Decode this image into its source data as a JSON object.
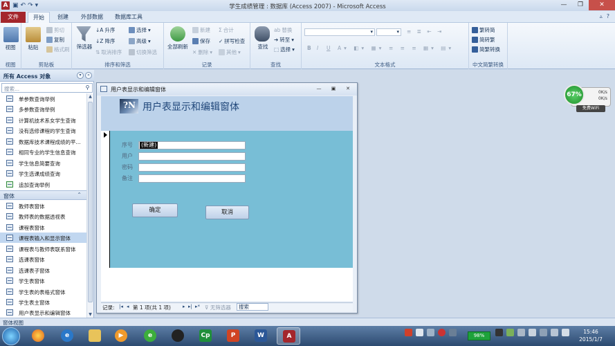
{
  "window": {
    "title": "学生成绩管理 : 数据库 (Access 2007) - Microsoft Access",
    "app_icon": "A"
  },
  "tabs": {
    "file": "文件",
    "items": [
      "开始",
      "创建",
      "外部数据",
      "数据库工具"
    ]
  },
  "ribbon": {
    "views": {
      "view": "视图",
      "label": "视图"
    },
    "clipboard": {
      "paste": "粘贴",
      "cut": "剪切",
      "copy": "复制",
      "format_painter": "格式刷",
      "label": "剪贴板"
    },
    "sort_filter": {
      "filter": "筛选器",
      "ascending": "升序",
      "descending": "降序",
      "clear_sort": "取消排序",
      "selection": "选择",
      "advanced": "高级",
      "toggle_filter": "切换筛选",
      "label": "排序和筛选"
    },
    "records": {
      "refresh_all": "全部刷新",
      "new": "新建",
      "save": "保存",
      "delete": "删除",
      "totals": "合计",
      "spelling": "拼写检查",
      "more": "其他",
      "label": "记录"
    },
    "find": {
      "find": "查找",
      "replace": "替换",
      "goto": "转至",
      "select": "选择",
      "label": "查找"
    },
    "text_format": {
      "bold": "B",
      "italic": "I",
      "underline": "U",
      "label": "文本格式"
    },
    "chinese": {
      "to_trad": "繁转简",
      "to_simp": "简转繁",
      "convert": "简繁转换",
      "label": "中文简繁转换"
    }
  },
  "nav": {
    "header": "所有 Access 对象",
    "search_placeholder": "搜索...",
    "query_items": [
      "单参数查询举例",
      "多参数查询举例",
      "计算机技术系女学生查询",
      "没有选修课程的学生查询",
      "数据库技术课程成绩的平...",
      "相同专业的学生信息查询",
      "学生信息简要查询",
      "学生选课成绩查询",
      "追加查询举例"
    ],
    "form_section": "窗体",
    "form_items": [
      "教师表窗体",
      "教师表的数据透视表",
      "课程表窗体",
      "课程表输入和显示窗体",
      "课程表与教师表联系窗体",
      "选课表窗体",
      "选课表子窗体",
      "学生表窗体",
      "学生表的表格式窗体",
      "学生表主窗体",
      "用户表显示和编辑窗体"
    ],
    "selected_form": 3
  },
  "form": {
    "window_title": "用户表显示和编辑窗体",
    "logo_text": "?N",
    "heading": "用户表显示和编辑窗体",
    "fields": [
      {
        "label": "序号",
        "value": "(新建)"
      },
      {
        "label": "用户",
        "value": ""
      },
      {
        "label": "密码",
        "value": ""
      },
      {
        "label": "备注",
        "value": ""
      }
    ],
    "ok_button": "确定",
    "cancel_button": "取消",
    "record_nav": {
      "label": "记录:",
      "position": "第 1 项(共 1 项)",
      "no_filter": "无筛选器",
      "search": "搜索"
    }
  },
  "widget": {
    "percent": "67%",
    "up": "0K/s",
    "down": "0K/s",
    "wifi": "免费WiFi"
  },
  "status_bar": "窗体视图",
  "taskbar": {
    "battery": "98%",
    "time": "15:46",
    "date": "2015/1/7"
  },
  "colors": {
    "accent": "#a4262c",
    "form_detail": "#78bed6",
    "form_header": "#bcd2ea"
  }
}
